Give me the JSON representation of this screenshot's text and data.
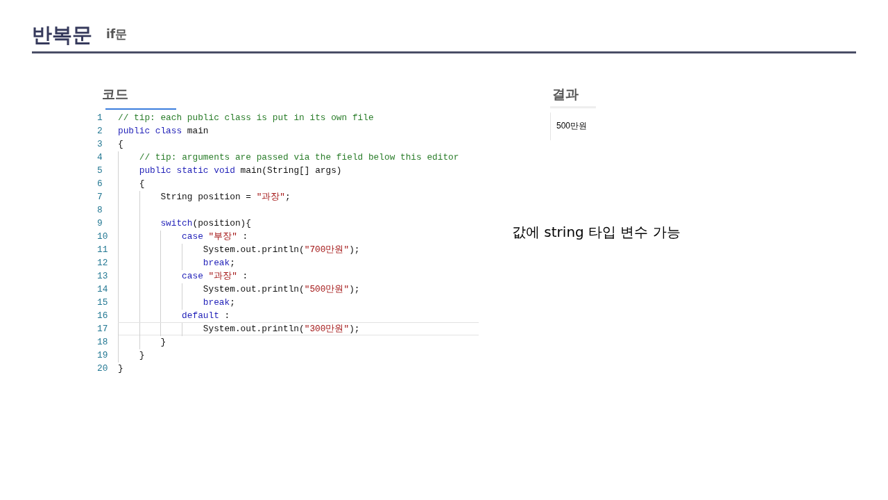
{
  "title": "반복문",
  "subtitle": "if문",
  "code_panel": {
    "title": "코드",
    "lines": [
      {
        "number": "1",
        "current": false,
        "tokens": [
          {
            "kind": "comment",
            "text": "// tip: each public class is put in its own file"
          }
        ]
      },
      {
        "number": "2",
        "current": false,
        "tokens": [
          {
            "kind": "keyword",
            "text": "public class"
          },
          {
            "kind": "plain",
            "text": " main"
          }
        ]
      },
      {
        "number": "3",
        "current": false,
        "tokens": [
          {
            "kind": "plain",
            "text": "{"
          }
        ]
      },
      {
        "number": "4",
        "current": false,
        "tokens": [
          {
            "kind": "comment",
            "text": "    // tip: arguments are passed via the field below this editor"
          }
        ]
      },
      {
        "number": "5",
        "current": false,
        "tokens": [
          {
            "kind": "keyword",
            "text": "    public static void"
          },
          {
            "kind": "plain",
            "text": " main(String[] args)"
          }
        ]
      },
      {
        "number": "6",
        "current": false,
        "tokens": [
          {
            "kind": "plain",
            "text": "    {"
          }
        ]
      },
      {
        "number": "7",
        "current": false,
        "tokens": [
          {
            "kind": "plain",
            "text": "        String position = "
          },
          {
            "kind": "string",
            "text": "\"과장\""
          },
          {
            "kind": "plain",
            "text": ";"
          }
        ]
      },
      {
        "number": "8",
        "current": false
      },
      {
        "number": "9",
        "current": false,
        "tokens": [
          {
            "kind": "keyword",
            "text": "        switch"
          },
          {
            "kind": "plain",
            "text": "(position){"
          }
        ]
      },
      {
        "number": "10",
        "current": false,
        "tokens": [
          {
            "kind": "keyword",
            "text": "            case"
          },
          {
            "kind": "string",
            "text": " \"부장\""
          },
          {
            "kind": "plain",
            "text": " :"
          }
        ]
      },
      {
        "number": "11",
        "current": false,
        "tokens": [
          {
            "kind": "plain",
            "text": "                System.out.println("
          },
          {
            "kind": "string",
            "text": "\"700만원\""
          },
          {
            "kind": "plain",
            "text": ");"
          }
        ]
      },
      {
        "number": "12",
        "current": false,
        "tokens": [
          {
            "kind": "keyword",
            "text": "                break"
          },
          {
            "kind": "plain",
            "text": ";"
          }
        ]
      },
      {
        "number": "13",
        "current": false,
        "tokens": [
          {
            "kind": "keyword",
            "text": "            case"
          },
          {
            "kind": "string",
            "text": " \"과장\""
          },
          {
            "kind": "plain",
            "text": " :"
          }
        ]
      },
      {
        "number": "14",
        "current": false,
        "tokens": [
          {
            "kind": "plain",
            "text": "                System.out.println("
          },
          {
            "kind": "string",
            "text": "\"500만원\""
          },
          {
            "kind": "plain",
            "text": ");"
          }
        ]
      },
      {
        "number": "15",
        "current": false,
        "tokens": [
          {
            "kind": "keyword",
            "text": "                break"
          },
          {
            "kind": "plain",
            "text": ";"
          }
        ]
      },
      {
        "number": "16",
        "current": false,
        "tokens": [
          {
            "kind": "keyword",
            "text": "            default"
          },
          {
            "kind": "plain",
            "text": " :"
          }
        ]
      },
      {
        "number": "17",
        "current": true,
        "tokens": [
          {
            "kind": "plain",
            "text": "                System.out.println("
          },
          {
            "kind": "string",
            "text": "\"300만원\""
          },
          {
            "kind": "plain",
            "text": ");"
          }
        ]
      },
      {
        "number": "18",
        "current": false,
        "tokens": [
          {
            "kind": "plain",
            "text": "        }"
          }
        ]
      },
      {
        "number": "19",
        "current": false,
        "tokens": [
          {
            "kind": "plain",
            "text": "    }"
          }
        ]
      },
      {
        "number": "20",
        "current": false,
        "tokens": [
          {
            "kind": "plain",
            "text": "}"
          }
        ]
      }
    ]
  },
  "result_panel": {
    "title": "결과",
    "output": "500만원"
  },
  "note": "값에 string 타입 변수 가능"
}
